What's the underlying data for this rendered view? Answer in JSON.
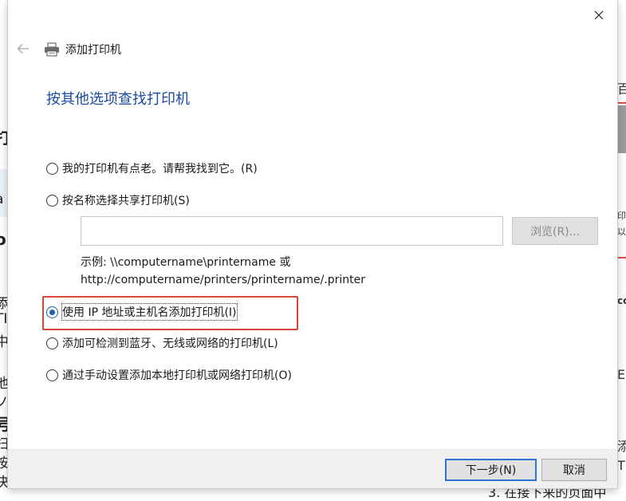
{
  "background": {
    "left_fragments": [
      "打",
      "a",
      "o",
      "添",
      "TI",
      "中",
      "他",
      "ノ",
      "号",
      "扫",
      "按",
      "决"
    ],
    "right_fragments": [
      "百",
      "印",
      "以",
      "co",
      "E",
      "添",
      "TI"
    ],
    "bottom_text": "3. 在接下来的页面中"
  },
  "dialog": {
    "title": "添加打印机",
    "heading": "按其他选项查找打印机",
    "options": [
      {
        "label": "我的打印机有点老。请帮我找到它。(R)",
        "checked": false
      },
      {
        "label": "按名称选择共享打印机(S)",
        "checked": false
      },
      {
        "label": "使用 IP 地址或主机名添加打印机(I)",
        "checked": true
      },
      {
        "label": "添加可检测到蓝牙、无线或网络的打印机(L)",
        "checked": false
      },
      {
        "label": "通过手动设置添加本地打印机或网络打印机(O)",
        "checked": false
      }
    ],
    "share_input": {
      "value": "",
      "placeholder": ""
    },
    "browse_label": "浏览(R)...",
    "example_line1": "示例: \\\\computername\\printername 或",
    "example_line2": "http://computername/printers/printername/.printer",
    "next_label": "下一步(N)",
    "cancel_label": "取消"
  },
  "icons": {
    "close": "close-icon",
    "back": "back-arrow-icon",
    "printer": "printer-icon"
  },
  "colors": {
    "heading": "#1c4aa0",
    "highlight": "#d9453c",
    "primary_button_border": "#2b74d1"
  }
}
